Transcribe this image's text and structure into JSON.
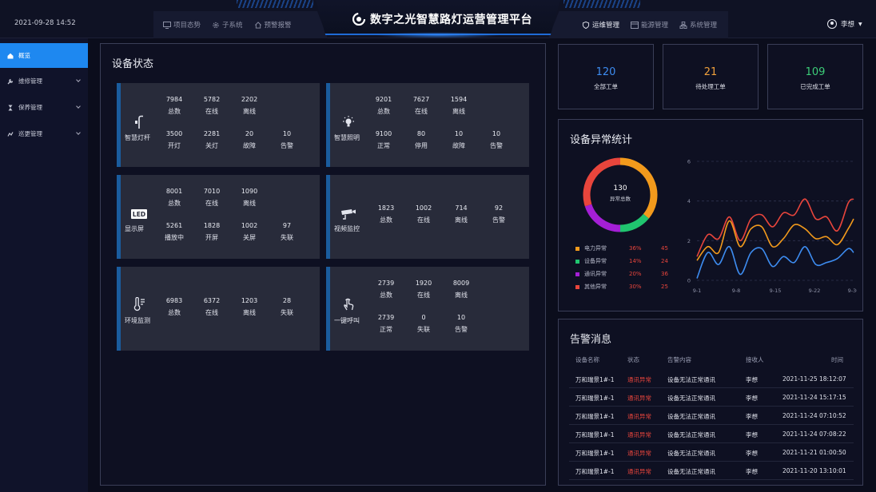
{
  "header": {
    "datetime": "2021-09-28 14:52",
    "title": "数字之光智慧路灯运营管理平台",
    "left_nav": [
      {
        "label": "项目态势",
        "icon": "monitor-icon"
      },
      {
        "label": "子系统",
        "icon": "gear-icon"
      },
      {
        "label": "预警报警",
        "icon": "house-icon"
      }
    ],
    "right_nav": [
      {
        "label": "运维管理",
        "icon": "shield-icon",
        "active": true
      },
      {
        "label": "能源管理",
        "icon": "card-icon"
      },
      {
        "label": "系统管理",
        "icon": "org-icon"
      }
    ],
    "user": "李想"
  },
  "sidebar": {
    "items": [
      {
        "label": "概览",
        "icon": "home-icon",
        "active": true
      },
      {
        "label": "维修管理",
        "icon": "wrench-icon"
      },
      {
        "label": "保养管理",
        "icon": "hourglass-icon"
      },
      {
        "label": "巡更管理",
        "icon": "patrol-icon"
      }
    ]
  },
  "device_status": {
    "title": "设备状态",
    "cards": [
      {
        "name": "智慧灯杆",
        "icon": "smart-pole-icon",
        "row1": [
          {
            "v": "7984",
            "l": "总数"
          },
          {
            "v": "5782",
            "l": "在线"
          },
          {
            "v": "2202",
            "l": "离线"
          }
        ],
        "row2": [
          {
            "v": "3500",
            "l": "开灯"
          },
          {
            "v": "2281",
            "l": "关灯"
          },
          {
            "v": "20",
            "l": "故障"
          },
          {
            "v": "10",
            "l": "告警"
          }
        ]
      },
      {
        "name": "智慧照明",
        "icon": "bulb-icon",
        "row1": [
          {
            "v": "9201",
            "l": "总数"
          },
          {
            "v": "7627",
            "l": "在线"
          },
          {
            "v": "1594",
            "l": "离线"
          }
        ],
        "row2": [
          {
            "v": "9100",
            "l": "正常"
          },
          {
            "v": "80",
            "l": "停用"
          },
          {
            "v": "10",
            "l": "故障"
          },
          {
            "v": "10",
            "l": "告警"
          }
        ]
      },
      {
        "name": "显示屏",
        "icon": "led-icon",
        "row1": [
          {
            "v": "8001",
            "l": "总数"
          },
          {
            "v": "7010",
            "l": "在线"
          },
          {
            "v": "1090",
            "l": "离线"
          }
        ],
        "row2": [
          {
            "v": "5261",
            "l": "播放中"
          },
          {
            "v": "1828",
            "l": "开屏"
          },
          {
            "v": "1002",
            "l": "关屏"
          },
          {
            "v": "97",
            "l": "失联"
          }
        ]
      },
      {
        "name": "视频监控",
        "icon": "camera-icon",
        "row1": [
          {
            "v": "1823",
            "l": "总数"
          },
          {
            "v": "1002",
            "l": "在线"
          },
          {
            "v": "714",
            "l": "离线"
          },
          {
            "v": "92",
            "l": "告警"
          }
        ],
        "row2": []
      },
      {
        "name": "环境监测",
        "icon": "thermometer-icon",
        "row1": [
          {
            "v": "6983",
            "l": "总数"
          },
          {
            "v": "6372",
            "l": "在线"
          },
          {
            "v": "1203",
            "l": "离线"
          },
          {
            "v": "28",
            "l": "失联"
          }
        ],
        "row2": []
      },
      {
        "name": "一键呼叫",
        "icon": "hand-icon",
        "row1": [
          {
            "v": "2739",
            "l": "总数"
          },
          {
            "v": "1920",
            "l": "在线"
          },
          {
            "v": "8009",
            "l": "离线"
          }
        ],
        "row2": [
          {
            "v": "2739",
            "l": "正常"
          },
          {
            "v": "0",
            "l": "失联"
          },
          {
            "v": "10",
            "l": "告警"
          }
        ]
      }
    ]
  },
  "kpis": [
    {
      "value": "120",
      "label": "全部工单",
      "color": "#3d8cf0"
    },
    {
      "value": "21",
      "label": "待处理工单",
      "color": "#f0a03c"
    },
    {
      "value": "109",
      "label": "已完成工单",
      "color": "#3ccd78"
    }
  ],
  "anomaly": {
    "title": "设备异常统计",
    "total": "130",
    "total_label": "异常总数",
    "legend": [
      {
        "name": "电力异常",
        "pct": "36%",
        "count": "45",
        "color": "#f29a1c"
      },
      {
        "name": "设备异常",
        "pct": "14%",
        "count": "24",
        "color": "#20c56f"
      },
      {
        "name": "通讯异常",
        "pct": "20%",
        "count": "36",
        "color": "#a41fd6"
      },
      {
        "name": "其他异常",
        "pct": "30%",
        "count": "25",
        "color": "#e8453c"
      }
    ]
  },
  "chart_data": [
    {
      "type": "pie",
      "title": "",
      "categories": [
        "电力异常",
        "设备异常",
        "通讯异常",
        "其他异常"
      ],
      "values": [
        36,
        14,
        20,
        30
      ],
      "colors": [
        "#f29a1c",
        "#20c56f",
        "#a41fd6",
        "#e8453c"
      ]
    },
    {
      "type": "line",
      "title": "",
      "x_ticks": [
        "9-1",
        "9-8",
        "9-15",
        "9-22",
        "9-30"
      ],
      "y_ticks": [
        "0",
        "2",
        "4",
        "6"
      ],
      "ylim": [
        0,
        6
      ],
      "x": [
        0,
        2,
        4,
        6,
        8,
        10,
        12,
        14,
        16,
        18,
        20,
        22,
        24,
        26,
        28,
        29
      ],
      "series": [
        {
          "color": "#e8453c",
          "values": [
            1.2,
            2.3,
            2.1,
            3.2,
            2.0,
            3.1,
            3.3,
            2.7,
            3.4,
            3.3,
            4.1,
            3.1,
            3.2,
            2.5,
            3.9,
            4.1
          ]
        },
        {
          "color": "#f29a1c",
          "values": [
            1.0,
            1.7,
            1.4,
            3.0,
            1.7,
            2.6,
            2.7,
            1.7,
            2.1,
            2.8,
            2.6,
            2.1,
            2.2,
            1.8,
            2.6,
            3.1
          ]
        },
        {
          "color": "#3d8cf0",
          "values": [
            0.1,
            1.4,
            0.8,
            1.7,
            0.3,
            1.4,
            1.6,
            0.7,
            1.2,
            0.9,
            1.7,
            0.8,
            0.9,
            1.1,
            1.6,
            1.4
          ]
        }
      ]
    }
  ],
  "alarm": {
    "title": "告警消息",
    "columns": [
      "设备名称",
      "状态",
      "告警内容",
      "接收人",
      "时间"
    ],
    "rows": [
      [
        "万和瑞景1#-1",
        "通讯异常",
        "设备无法正常通讯",
        "李想",
        "2021-11-25 18:12:07"
      ],
      [
        "万和瑞景1#-1",
        "通讯异常",
        "设备无法正常通讯",
        "李想",
        "2021-11-24 15:17:15"
      ],
      [
        "万和瑞景1#-1",
        "通讯异常",
        "设备无法正常通讯",
        "李想",
        "2021-11-24 07:10:52"
      ],
      [
        "万和瑞景1#-1",
        "通讯异常",
        "设备无法正常通讯",
        "李想",
        "2021-11-24 07:08:22"
      ],
      [
        "万和瑞景1#-1",
        "通讯异常",
        "设备无法正常通讯",
        "李想",
        "2021-11-21 01:00:50"
      ],
      [
        "万和瑞景1#-1",
        "通讯异常",
        "设备无法正常通讯",
        "李想",
        "2021-11-20 13:10:01"
      ]
    ]
  }
}
